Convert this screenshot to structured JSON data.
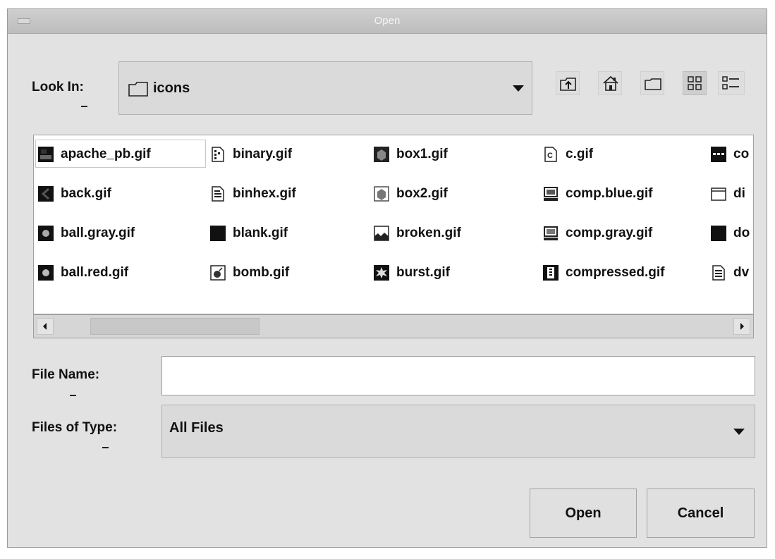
{
  "window": {
    "title": "Open"
  },
  "look_in": {
    "label": "Look In:",
    "value": "icons"
  },
  "toolbar": {
    "up_one_level": "up-folder-icon",
    "home": "home-icon",
    "new_folder": "new-folder-icon",
    "list_view": "list-view-icon",
    "details_view": "details-view-icon"
  },
  "files": [
    {
      "name": "apache_pb.gif",
      "selected": true
    },
    {
      "name": "back.gif"
    },
    {
      "name": "ball.gray.gif"
    },
    {
      "name": "ball.red.gif"
    },
    {
      "name": "binary.gif"
    },
    {
      "name": "binhex.gif"
    },
    {
      "name": "blank.gif"
    },
    {
      "name": "bomb.gif"
    },
    {
      "name": "box1.gif"
    },
    {
      "name": "box2.gif"
    },
    {
      "name": "broken.gif"
    },
    {
      "name": "burst.gif"
    },
    {
      "name": "c.gif"
    },
    {
      "name": "comp.blue.gif"
    },
    {
      "name": "comp.gray.gif"
    },
    {
      "name": "compressed.gif"
    },
    {
      "name": "co"
    },
    {
      "name": "di"
    },
    {
      "name": "do"
    },
    {
      "name": "dv"
    }
  ],
  "file_name": {
    "label": "File Name:",
    "value": ""
  },
  "file_type": {
    "label": "Files of Type:",
    "value": "All Files"
  },
  "buttons": {
    "open": "Open",
    "cancel": "Cancel"
  }
}
